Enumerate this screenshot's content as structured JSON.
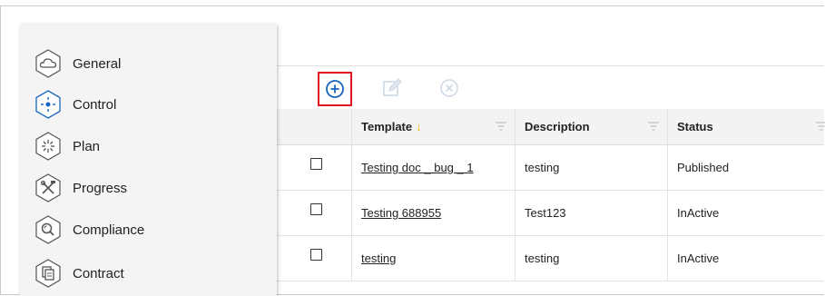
{
  "sidebar": {
    "items": [
      {
        "label": "General",
        "icon": "cloud-icon"
      },
      {
        "label": "Control",
        "icon": "target-icon"
      },
      {
        "label": "Plan",
        "icon": "sparkle-icon"
      },
      {
        "label": "Progress",
        "icon": "tools-icon"
      },
      {
        "label": "Compliance",
        "icon": "search-icon"
      },
      {
        "label": "Contract",
        "icon": "documents-icon"
      }
    ]
  },
  "toolbar": {
    "add_icon": "plus-circle-icon",
    "edit_icon": "edit-icon",
    "cancel_icon": "x-circle-icon",
    "highlight_color": "#e0141e",
    "accent_color": "#1565c0"
  },
  "table": {
    "columns": [
      "Template",
      "Description",
      "Status"
    ],
    "sort_indicator": "↓",
    "rows": [
      {
        "template": "Testing doc _ bug _ 1",
        "description": "testing",
        "status": "Published"
      },
      {
        "template": "Testing 688955",
        "description": "Test123",
        "status": "InActive"
      },
      {
        "template": "testing",
        "description": "testing",
        "status": "InActive"
      }
    ]
  }
}
